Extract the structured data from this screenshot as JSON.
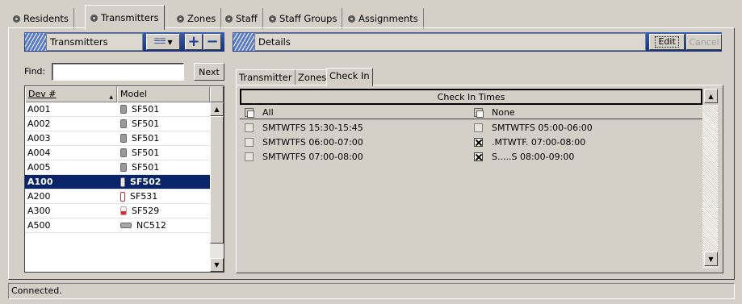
{
  "main_tabs": [
    {
      "label": "Residents"
    },
    {
      "label": "Transmitters"
    },
    {
      "label": "Zones"
    },
    {
      "label": "Staff"
    },
    {
      "label": "Staff Groups"
    },
    {
      "label": "Assignments"
    }
  ],
  "left_panel": {
    "title": "Transmitters",
    "find_label": "Find:",
    "find_value": "",
    "next_label": "Next",
    "columns": [
      "Dev #",
      "Model"
    ],
    "rows": [
      {
        "dev": "A001",
        "model": "SF501",
        "icon": "pendant-gray-icon"
      },
      {
        "dev": "A002",
        "model": "SF501",
        "icon": "pendant-gray-icon"
      },
      {
        "dev": "A003",
        "model": "SF501",
        "icon": "pendant-gray-icon"
      },
      {
        "dev": "A004",
        "model": "SF501",
        "icon": "pendant-gray-icon"
      },
      {
        "dev": "A005",
        "model": "SF501",
        "icon": "pendant-gray-icon"
      },
      {
        "dev": "A100",
        "model": "SF502",
        "icon": "wrist-device-icon",
        "selected": true
      },
      {
        "dev": "A200",
        "model": "SF531",
        "icon": "pull-cord-icon"
      },
      {
        "dev": "A300",
        "model": "SF529",
        "icon": "red-sensor-icon"
      },
      {
        "dev": "A500",
        "model": "NC512",
        "icon": "nurse-call-icon"
      }
    ]
  },
  "details_panel": {
    "title": "Details",
    "edit_label": "Edit",
    "cancel_label": "Cancel",
    "tabs": [
      "Transmitter",
      "Zones",
      "Check In"
    ],
    "active_tab": "Check In",
    "check_in_header": "Check In Times",
    "all_label": "All",
    "none_label": "None",
    "left_times": [
      {
        "label": "SMTWTFS 15:30-15:45",
        "checked": false
      },
      {
        "label": "SMTWTFS 06:00-07:00",
        "checked": false
      },
      {
        "label": "SMTWTFS 07:00-08:00",
        "checked": false
      }
    ],
    "right_times": [
      {
        "label": "SMTWTFS 05:00-06:00",
        "checked": false
      },
      {
        "label": ".MTWTF. 07:00-08:00",
        "checked": true
      },
      {
        "label": "S.....S 08:00-09:00",
        "checked": true
      }
    ]
  },
  "status": {
    "text": "Connected."
  },
  "colors": {
    "header_blue": "#14317d",
    "selection": "#0a246a",
    "window_gray": "#d4d0c8"
  }
}
